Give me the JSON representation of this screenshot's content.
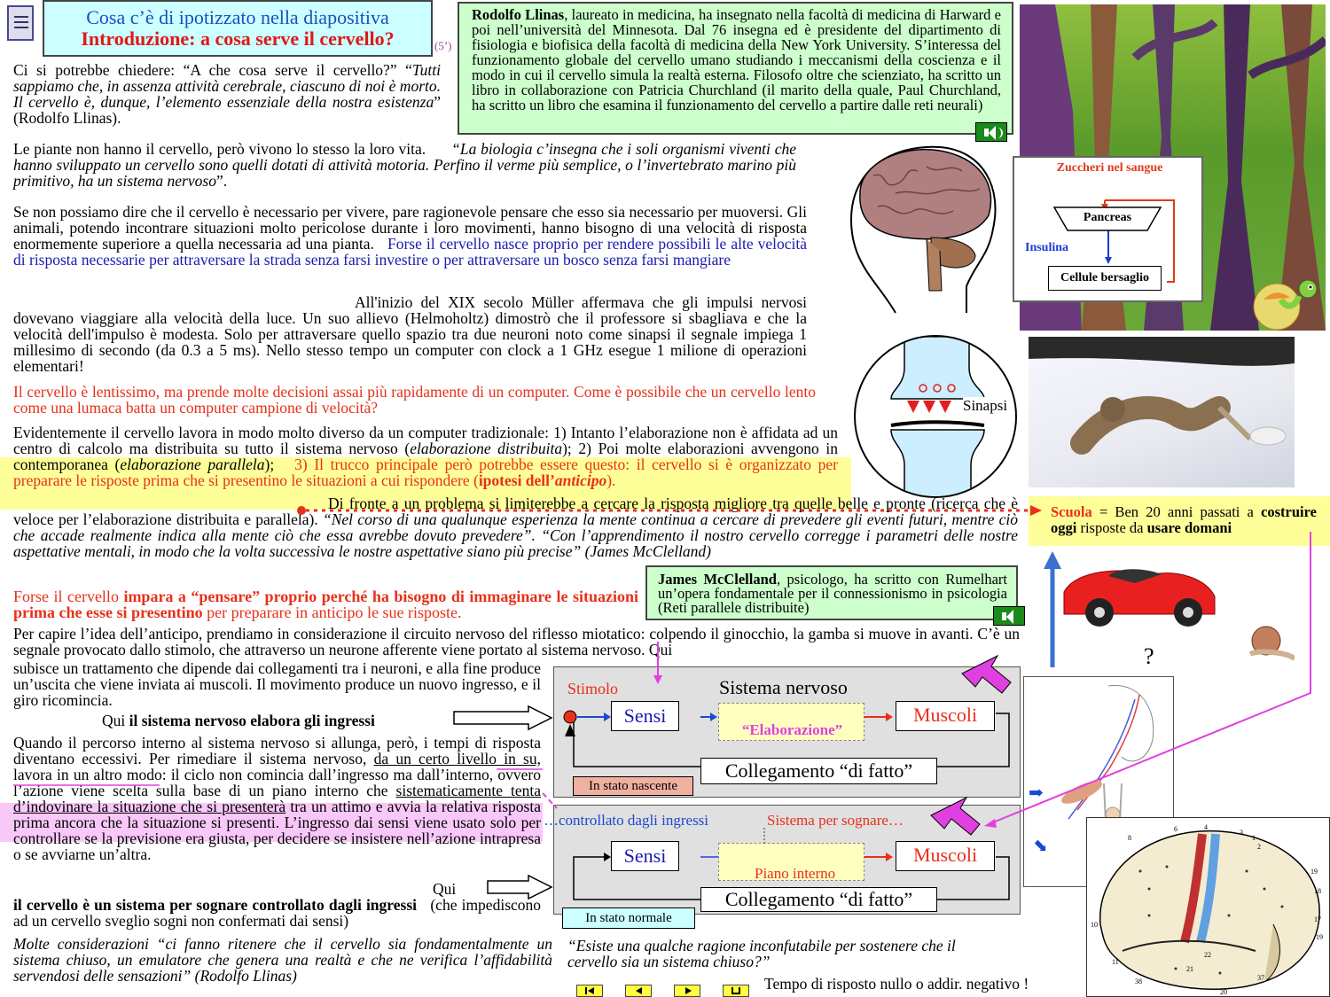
{
  "header": {
    "title": "Cosa c’è di ipotizzato nella diapositiva",
    "subtitle": "Introduzione: a cosa serve il cervello?",
    "time": "(5’)"
  },
  "llinas_box": {
    "name": "Rodolfo Llinas",
    "text": ", laureato in medicina, ha insegnato nella facoltà di medicina di Harward e poi nell’università del Minnesota. Dal 76 insegna ed è presidente del dipartimento di fisiologia e biofisica della facoltà di medicina della New York University. S’interessa del funzionamento globale del cervello umano studiando i meccanismi della coscienza e il modo in cui il cervello simula la realtà esterna. Filosofo oltre che scienziato, ha scritto un libro in collaborazione con Patricia Churchland (il marito della quale, Paul Churchland, ha scritto un libro che esamina il funzionamento del cervello a partire dalle reti neurali)"
  },
  "p1": {
    "a": "Ci si potrebbe chiedere: “A che cosa serve il cervello?” “",
    "b": "Tutti sappiamo che, in assenza attività cerebrale, ciascuno di noi è morto. Il cervello è, dunque, l’elemento essenziale della nostra esistenza",
    "c": "” (Rodolfo Llinas)."
  },
  "p2": {
    "a": "Le piante non hanno il cervello, però vivono lo stesso la loro vita.",
    "b": "“La biologia c’insegna che i soli organismi viventi che hanno sviluppato un cervello sono quelli dotati di attività motoria. Perfino il verme più semplice, o l’invertebrato marino più primitivo, ha un sistema nervoso",
    "c": "”."
  },
  "p3": {
    "a": "Se non possiamo dire che il cervello è necessario per vivere, pare ragionevole pensare che esso sia necessario per muoversi. Gli animali, potendo incontrare situazioni molto pericolose durante i loro movimenti, hanno bisogno di una velocità di risposta enormemente superiore a quella necessaria ad una pianta.",
    "b": "Forse il cervello nasce proprio per rendere possibili le alte velocità di risposta necessarie per attraversare la strada senza farsi investire o per attraversare un bosco senza farsi mangiare"
  },
  "p4": "All'inizio del XIX secolo Müller affermava che gli impulsi nervosi dovevano viaggiare alla velocità della luce. Un suo allievo (Helmoholtz) dimostrò che il professore si sbagliava e che la velocità dell'impulso è modesta. Solo per attraversare quello spazio tra due neuroni noto come sinapsi il segnale impiega 1 millesimo di secondo (da 0.3 a 5 ms). Nello stesso tempo un computer con clock a 1 GHz esegue 1 milione di operazioni elementari!",
  "p5": "Il cervello è lentissimo, ma prende molte decisioni assai più rapidamente di un computer. Come è possibile che un cervello lento come una lumaca batta un computer campione di velocità?",
  "p6": {
    "a": "Evidentemente il cervello lavora in modo molto diverso da un computer tradizionale: 1) Intanto l’elaborazione non è affidata ad un centro di calcolo ma distribuita su tutto il sistema nervoso (",
    "b": "elaborazione distribuita",
    "c": ");",
    "d": "2) Poi molte elaborazioni avvengono in contemporanea (",
    "e": "elaborazione parallela",
    "f": ");",
    "g": "3) Il trucco principale però potrebbe essere questo: il cervello si è organizzato per preparare le risposte prima che si presentino le situazioni a cui rispondere (",
    "h": "ipotesi dell’",
    "hi": "anticipo",
    "h2": ").",
    "k": "Di fronte a un problema si limiterebbe a cercare la risposta migliore tra quelle belle e pronte (ricerca che è veloce per l’elaborazione distribuita e parallela).",
    "l": "“Nel corso di una qualunque esperienza la mente continua a cercare di prevedere gli eventi futuri, mentre ciò che accade realmente indica alla mente ciò che essa avrebbe dovuto prevedere”. “Con l’apprendimento il nostro cervello corregge i parametri delle nostre aspettative mentali, in modo che la volta successiva le nostre aspettative siano più precise”",
    "m": "(James McClelland)"
  },
  "p7": {
    "a": "Forse il cervello ",
    "b": "impara a “pensare” proprio perché ha bisogno di immaginare le situazioni prima che esse si presentino",
    "c": " per preparare in anticipo le sue risposte."
  },
  "p8": {
    "a": "Per capire l’idea dell’anticipo, prendiamo in considerazione il circuito nervoso del riflesso miotatico: colpendo il ginocchio, la gamba si muove in avanti. C’è un segnale provocato dallo stimolo, che attraverso un neurone afferente viene portato al sistema nervoso. Qui",
    "b": "subisce un trattamento che dipende dai collegamenti tra i neuroni, e alla fine produce un’uscita che viene inviata ai muscoli. Il movimento produce un nuovo ingresso, e il giro ricomincia.",
    "c": "Qui ",
    "d": "il sistema nervoso elabora gli ingressi"
  },
  "p9": {
    "a": "Quando il percorso interno al sistema nervoso si allunga, però, i tempi di risposta diventano eccessivi. Per rimediare il sistema nervoso, ",
    "b": "da un certo livello in su,",
    "c": " lavora in un altro modo: il ciclo non comincia dall’ingresso ma dall’interno, ovvero l’azione viene scelta sulla base di un piano interno che ",
    "d": "sistematicamente tenta d’indovinare la situazione che si presenterà",
    "e": " tra un attimo e avvia la relativa risposta prima ancora che la situazione si presenti. L’ingresso dai sensi viene usato solo per controllare se la previsione era giusta, per decidere se insistere nell’azione intrapresa o se avviarne un’altra.",
    "f": "Qui",
    "g": "il cervello è un sistema per sognare controllato dagli ingressi",
    "h": "(che impediscono ad un cervello sveglio sogni non confermati dai sensi)"
  },
  "p10": "Molte considerazioni “ci fanno ritenere che il cervello sia fondamentalmente un sistema chiuso, un emulatore che genera una realtà e che ne verifica l’affidabilità servendosi delle sensazioni” (Rodolfo Llinas)",
  "quote2": "“Esiste una qualche ragione inconfutabile per sostenere che il cervello sia un sistema chiuso?”",
  "tempo": "Tempo di risposto nullo o addir. negativo !",
  "mcclelland": {
    "name": "James McClelland",
    "text": ", psicologo, ha scritto con Rumelhart un’opera fondamentale per il connessionismo in psicologia (Reti parallele distribuite)"
  },
  "sugar": {
    "title": "Zuccheri nel sangue",
    "pancreas": "Pancreas",
    "insulina": "Insulina",
    "cells": "Cellule bersaglio"
  },
  "synapse": {
    "label": "Sinapsi"
  },
  "scuola": {
    "a": "Scuola",
    "b": " = Ben 20 anni passati a ",
    "c": "costruire oggi",
    "d": " risposte da ",
    "e": "usare domani"
  },
  "car_question": "?",
  "diagram1": {
    "stimolo": "Stimolo",
    "title": "Sistema nervoso",
    "sensi": "Sensi",
    "elab": "“Elaborazione”",
    "muscoli": "Muscoli",
    "collegamento": "Collegamento “di fatto”",
    "state": "In stato nascente"
  },
  "diagram2": {
    "controllato": "…controllato dagli ingressi",
    "sognare": "Sistema per sognare…",
    "sensi": "Sensi",
    "piano": "Piano interno",
    "muscoli": "Muscoli",
    "collegamento": "Collegamento “di fatto”",
    "state": "In stato normale"
  },
  "brainmap": {
    "labels": [
      "8",
      "6",
      "4",
      "3",
      "1",
      "2",
      "19",
      "18",
      "17",
      "19",
      "11",
      "10",
      "38",
      "20",
      "37",
      "22",
      "21",
      "7",
      "9",
      "5"
    ]
  },
  "colors": {
    "title_blue": "#1a4fc0",
    "title_red": "#e01818",
    "green_box": "#ccffcc",
    "yellow_hl": "#ffff99",
    "pink_hl": "#f8c8f8",
    "diagram_bg": "#e0e0e0"
  }
}
